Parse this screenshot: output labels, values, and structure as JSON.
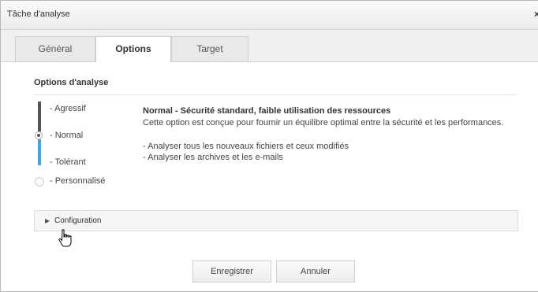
{
  "window": {
    "title": "Tâche d'analyse",
    "close_icon": "×"
  },
  "tabs": [
    {
      "label": "Général",
      "active": false
    },
    {
      "label": "Options",
      "active": true
    },
    {
      "label": "Target",
      "active": false
    }
  ],
  "options": {
    "section_title": "Options d'analyse",
    "levels": {
      "aggressive": "- Agressif",
      "normal": "- Normal",
      "tolerant": "- Tolérant",
      "custom": "- Personnalisé"
    },
    "selected_level": "Normal",
    "description": {
      "title": "Normal - Sécurité standard, faible utilisation des ressources",
      "line1": "Cette option est conçue pour fournir un équilibre optimal entre la sécurité et les performances.",
      "line2": "- Analyser tous les nouveaux fichiers et ceux modifiés",
      "line3": "- Analyser les archives et les e-mails"
    }
  },
  "configuration": {
    "label": "Configuration",
    "expanded": false
  },
  "buttons": {
    "save": "Enregistrer",
    "cancel": "Annuler"
  },
  "colors": {
    "slider_accent": "#3fa6e0",
    "slider_dark": "#555555"
  }
}
